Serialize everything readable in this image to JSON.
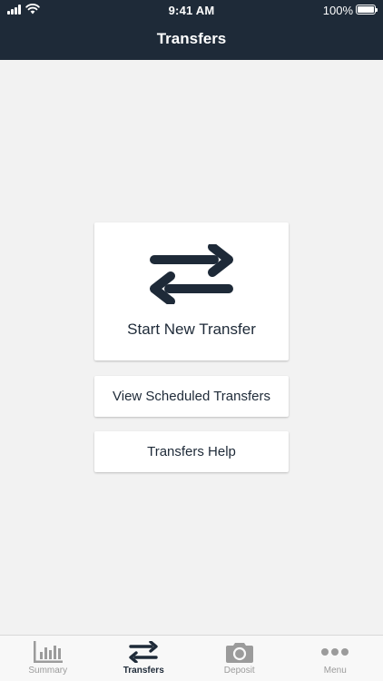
{
  "status_bar": {
    "time": "9:41 AM",
    "battery": "100%",
    "icons": [
      "signal-icon",
      "wifi-icon",
      "battery-icon"
    ]
  },
  "nav": {
    "title": "Transfers"
  },
  "actions": {
    "start_label": "Start New Transfer",
    "scheduled_label": "View Scheduled Transfers",
    "help_label": "Transfers Help"
  },
  "tabs": [
    {
      "label": "Summary",
      "icon": "bar-chart-icon",
      "active": false
    },
    {
      "label": "Transfers",
      "icon": "transfer-arrows-icon",
      "active": true
    },
    {
      "label": "Deposit",
      "icon": "camera-icon",
      "active": false
    },
    {
      "label": "Menu",
      "icon": "more-dots-icon",
      "active": false
    }
  ],
  "colors": {
    "header_bg": "#1e2a38",
    "accent_dark": "#1e2a38",
    "background": "#f2f2f2",
    "inactive_tab": "#9b9b9b"
  }
}
